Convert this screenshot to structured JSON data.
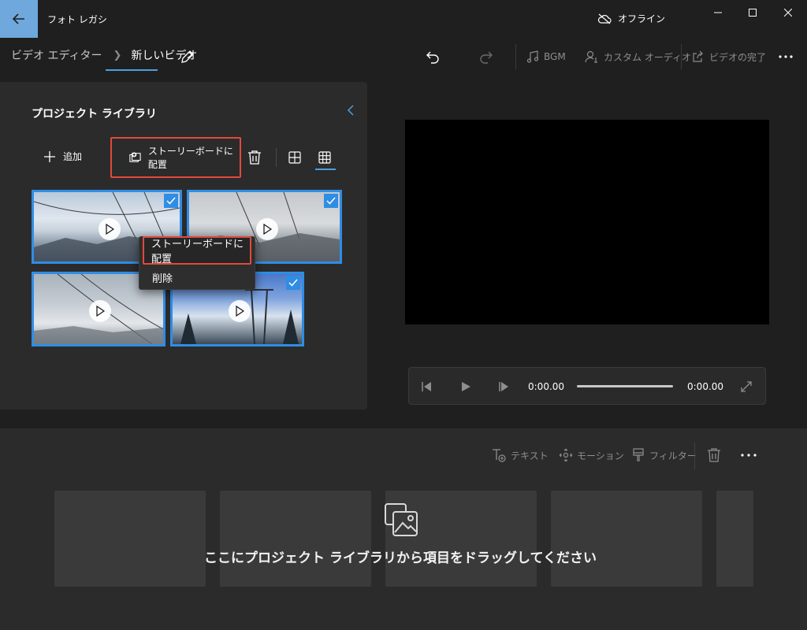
{
  "window": {
    "app_title": "フォト レガシ",
    "offline_label": "オフライン"
  },
  "header": {
    "breadcrumb_root": "ビデオ エディター",
    "breadcrumb_current": "新しいビデオ",
    "bgm_label": "BGM",
    "custom_audio_label": "カスタム オーディオ",
    "finish_video_label": "ビデオの完了"
  },
  "library": {
    "title": "プロジェクト ライブラリ",
    "add_label": "追加",
    "storyboard_label": "ストーリーボードに配置",
    "thumbnails": [
      {
        "selected": true
      },
      {
        "selected": true
      },
      {
        "selected": false
      },
      {
        "selected": true
      }
    ]
  },
  "context_menu": {
    "items": [
      "ストーリーボードに配置",
      "削除"
    ]
  },
  "player": {
    "current_time": "0:00.00",
    "total_time": "0:00.00"
  },
  "storyboard": {
    "text_label": "テキスト",
    "motion_label": "モーション",
    "filter_label": "フィルター",
    "empty_message": "ここにプロジェクト ライブラリから項目をドラッグしてください"
  },
  "colors": {
    "accent": "#2f8de4",
    "highlight_border": "#e04a3c",
    "back_button": "#6fa8dc"
  }
}
